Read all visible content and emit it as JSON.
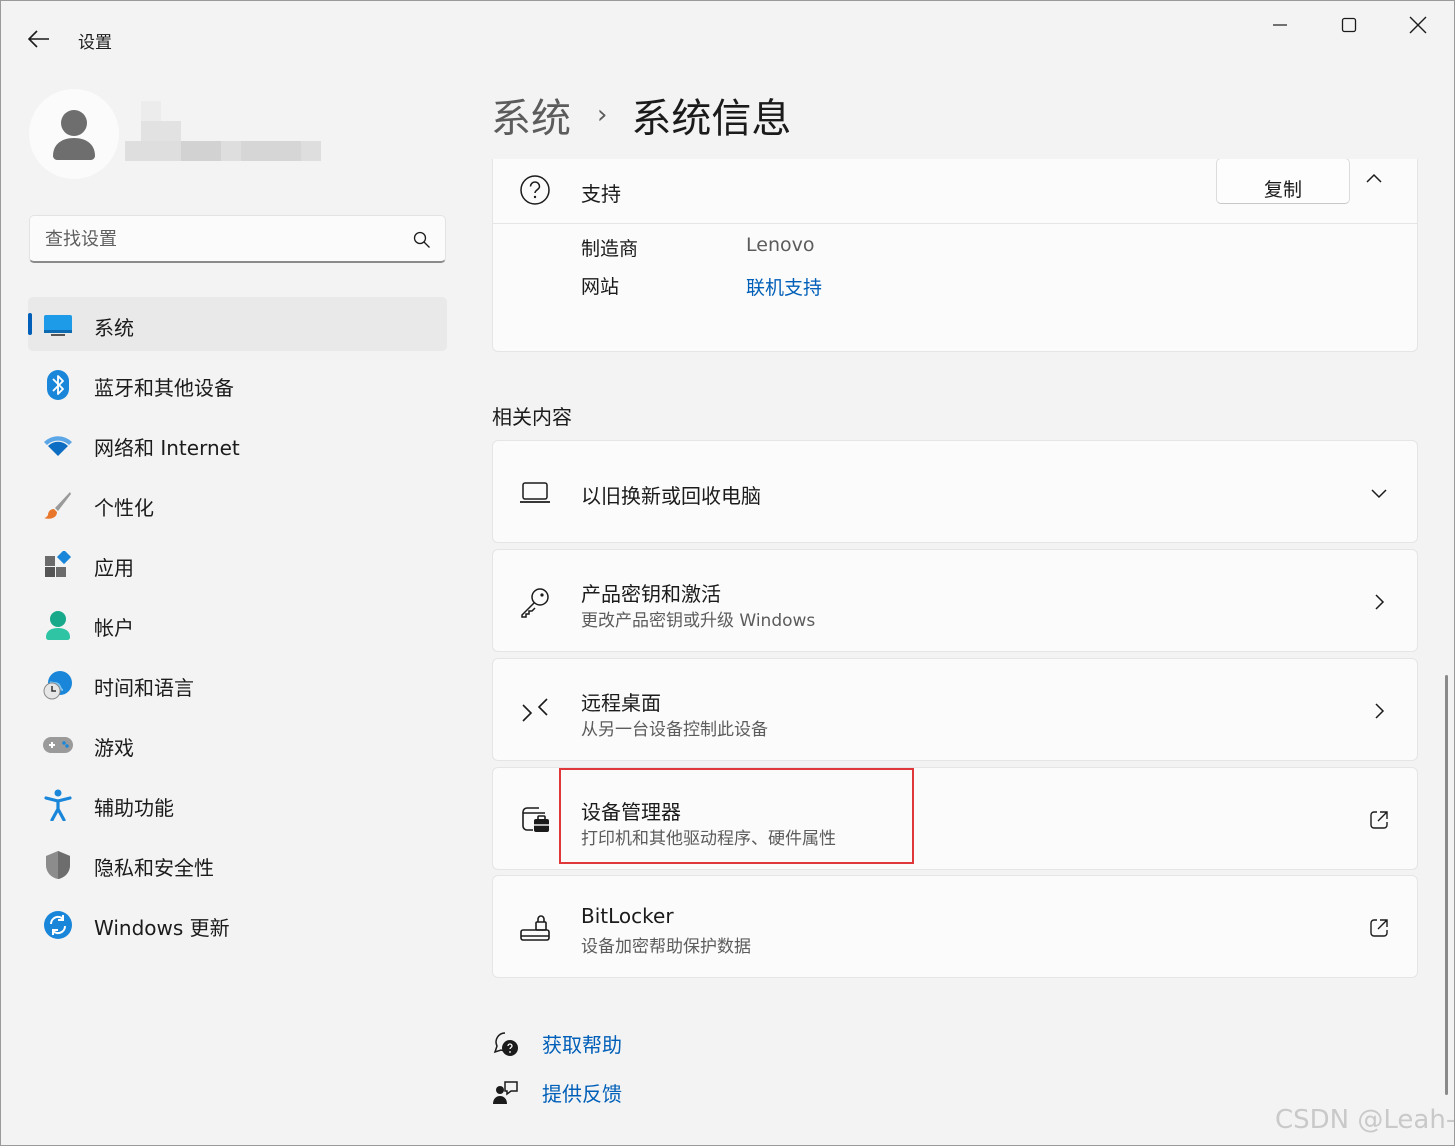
{
  "window": {
    "app_title": "设置",
    "controls": {
      "minimize": "minimize",
      "maximize": "maximize",
      "close": "close"
    }
  },
  "search": {
    "placeholder": "查找设置"
  },
  "sidebar": {
    "items": [
      {
        "label": "系统",
        "icon": "system-icon",
        "active": true
      },
      {
        "label": "蓝牙和其他设备",
        "icon": "bluetooth-icon",
        "active": false
      },
      {
        "label": "网络和 Internet",
        "icon": "wifi-icon",
        "active": false
      },
      {
        "label": "个性化",
        "icon": "brush-icon",
        "active": false
      },
      {
        "label": "应用",
        "icon": "apps-icon",
        "active": false
      },
      {
        "label": "帐户",
        "icon": "account-icon",
        "active": false
      },
      {
        "label": "时间和语言",
        "icon": "time-language-icon",
        "active": false
      },
      {
        "label": "游戏",
        "icon": "gamepad-icon",
        "active": false
      },
      {
        "label": "辅助功能",
        "icon": "accessibility-icon",
        "active": false
      },
      {
        "label": "隐私和安全性",
        "icon": "shield-icon",
        "active": false
      },
      {
        "label": "Windows 更新",
        "icon": "windows-update-icon",
        "active": false
      }
    ]
  },
  "header": {
    "breadcrumb_parent": "系统",
    "breadcrumb_separator": "›",
    "breadcrumb_current": "系统信息"
  },
  "support": {
    "label": "支持",
    "copy_label": "复制",
    "rows": [
      {
        "key": "制造商",
        "value": "Lenovo"
      },
      {
        "key": "网站",
        "value": "联机支持"
      }
    ]
  },
  "related": {
    "section_title": "相关内容",
    "items": [
      {
        "title": "以旧换新或回收电脑",
        "subtitle": "",
        "icon": "laptop-icon",
        "action": "chevron-down-icon"
      },
      {
        "title": "产品密钥和激活",
        "subtitle": "更改产品密钥或升级 Windows",
        "icon": "key-icon",
        "action": "chevron-right-icon"
      },
      {
        "title": "远程桌面",
        "subtitle": "从另一台设备控制此设备",
        "icon": "remote-desktop-icon",
        "action": "chevron-right-icon"
      },
      {
        "title": "设备管理器",
        "subtitle": "打印机和其他驱动程序、硬件属性",
        "icon": "device-manager-icon",
        "action": "external-link-icon"
      },
      {
        "title": "BitLocker",
        "subtitle": "设备加密帮助保护数据",
        "icon": "bitlocker-icon",
        "action": "external-link-icon"
      }
    ]
  },
  "help": {
    "get_help": "获取帮助",
    "give_feedback": "提供反馈"
  },
  "colors": {
    "accent": "#005fb8",
    "highlight": "#e0383a"
  },
  "watermark": "CSDN @Leah-"
}
